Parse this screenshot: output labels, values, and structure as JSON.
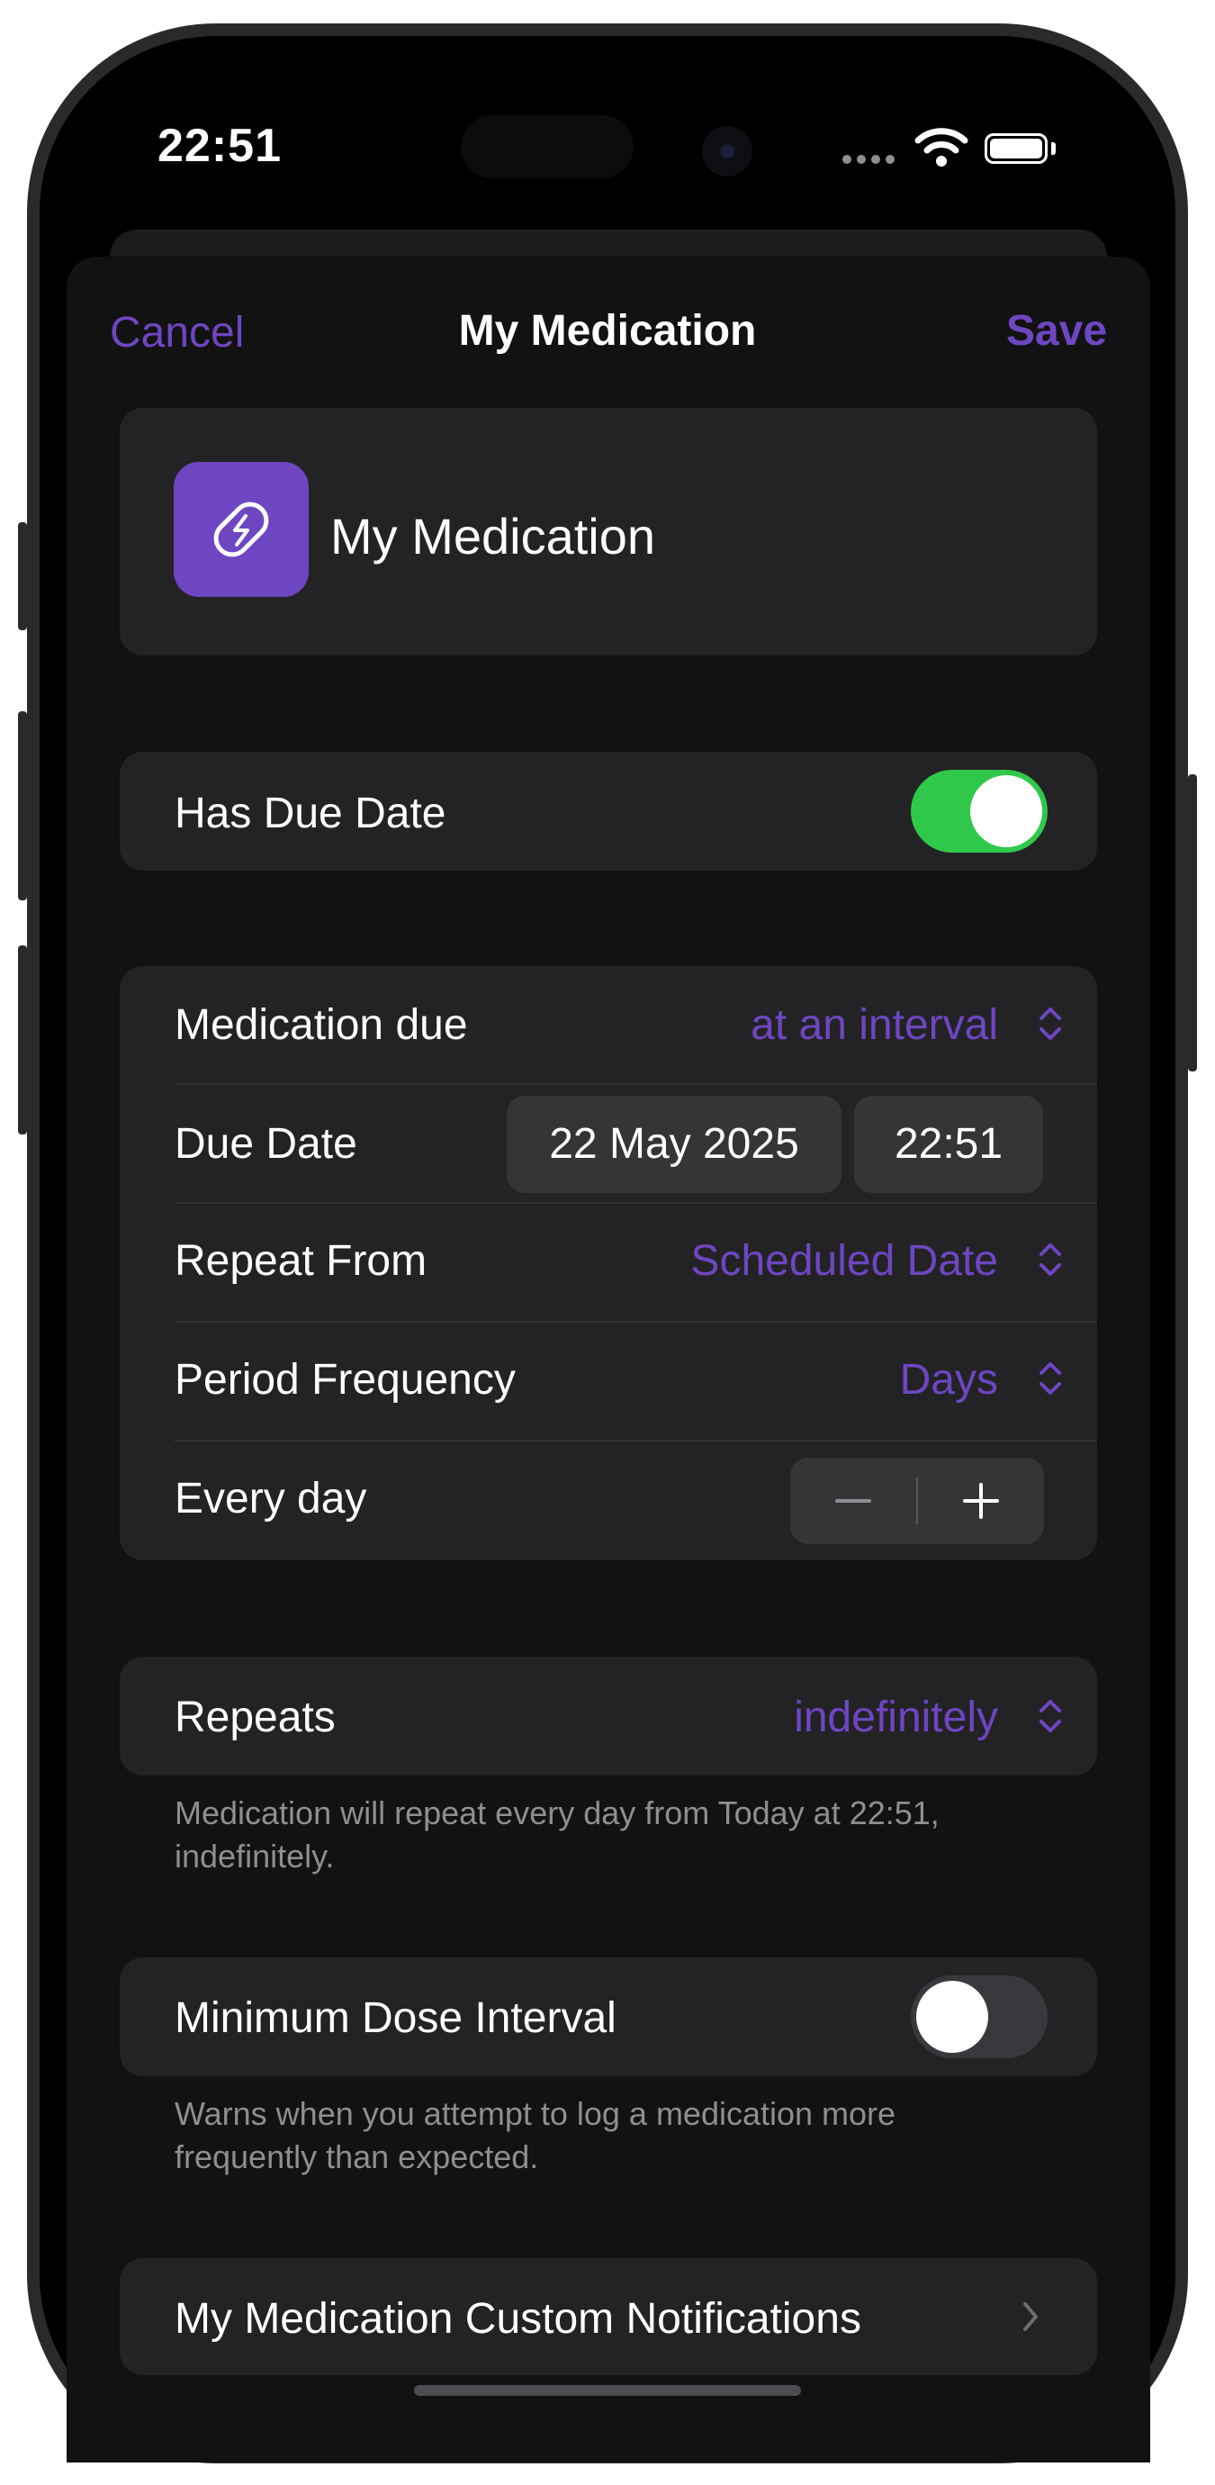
{
  "status_bar": {
    "time": "22:51"
  },
  "nav": {
    "cancel_label": "Cancel",
    "title": "My Medication",
    "save_label": "Save"
  },
  "medication": {
    "name": "My Medication",
    "icon": "pill-icon",
    "icon_color": "#6e46c2"
  },
  "has_due_date": {
    "label": "Has Due Date",
    "enabled": true
  },
  "schedule": {
    "medication_due_label": "Medication due",
    "medication_due_value": "at an interval",
    "due_date_label": "Due Date",
    "due_date_value": "22 May 2025",
    "due_time_value": "22:51",
    "repeat_from_label": "Repeat From",
    "repeat_from_value": "Scheduled Date",
    "period_frequency_label": "Period Frequency",
    "period_frequency_value": "Days",
    "every_label": "Every day"
  },
  "repeats": {
    "label": "Repeats",
    "value": "indefinitely",
    "footnote": "Medication will repeat every day from Today at 22:51, indefinitely."
  },
  "min_dose_interval": {
    "label": "Minimum Dose Interval",
    "enabled": false,
    "footnote": "Warns when you attempt to log a medication more frequently than expected."
  },
  "custom_notifications": {
    "label": "My Medication Custom Notifications"
  },
  "colors": {
    "accent": "#6e46c2",
    "toggle_on": "#30c84b",
    "toggle_off": "#39393d",
    "card_bg": "#232325",
    "sheet_bg": "#121213"
  }
}
